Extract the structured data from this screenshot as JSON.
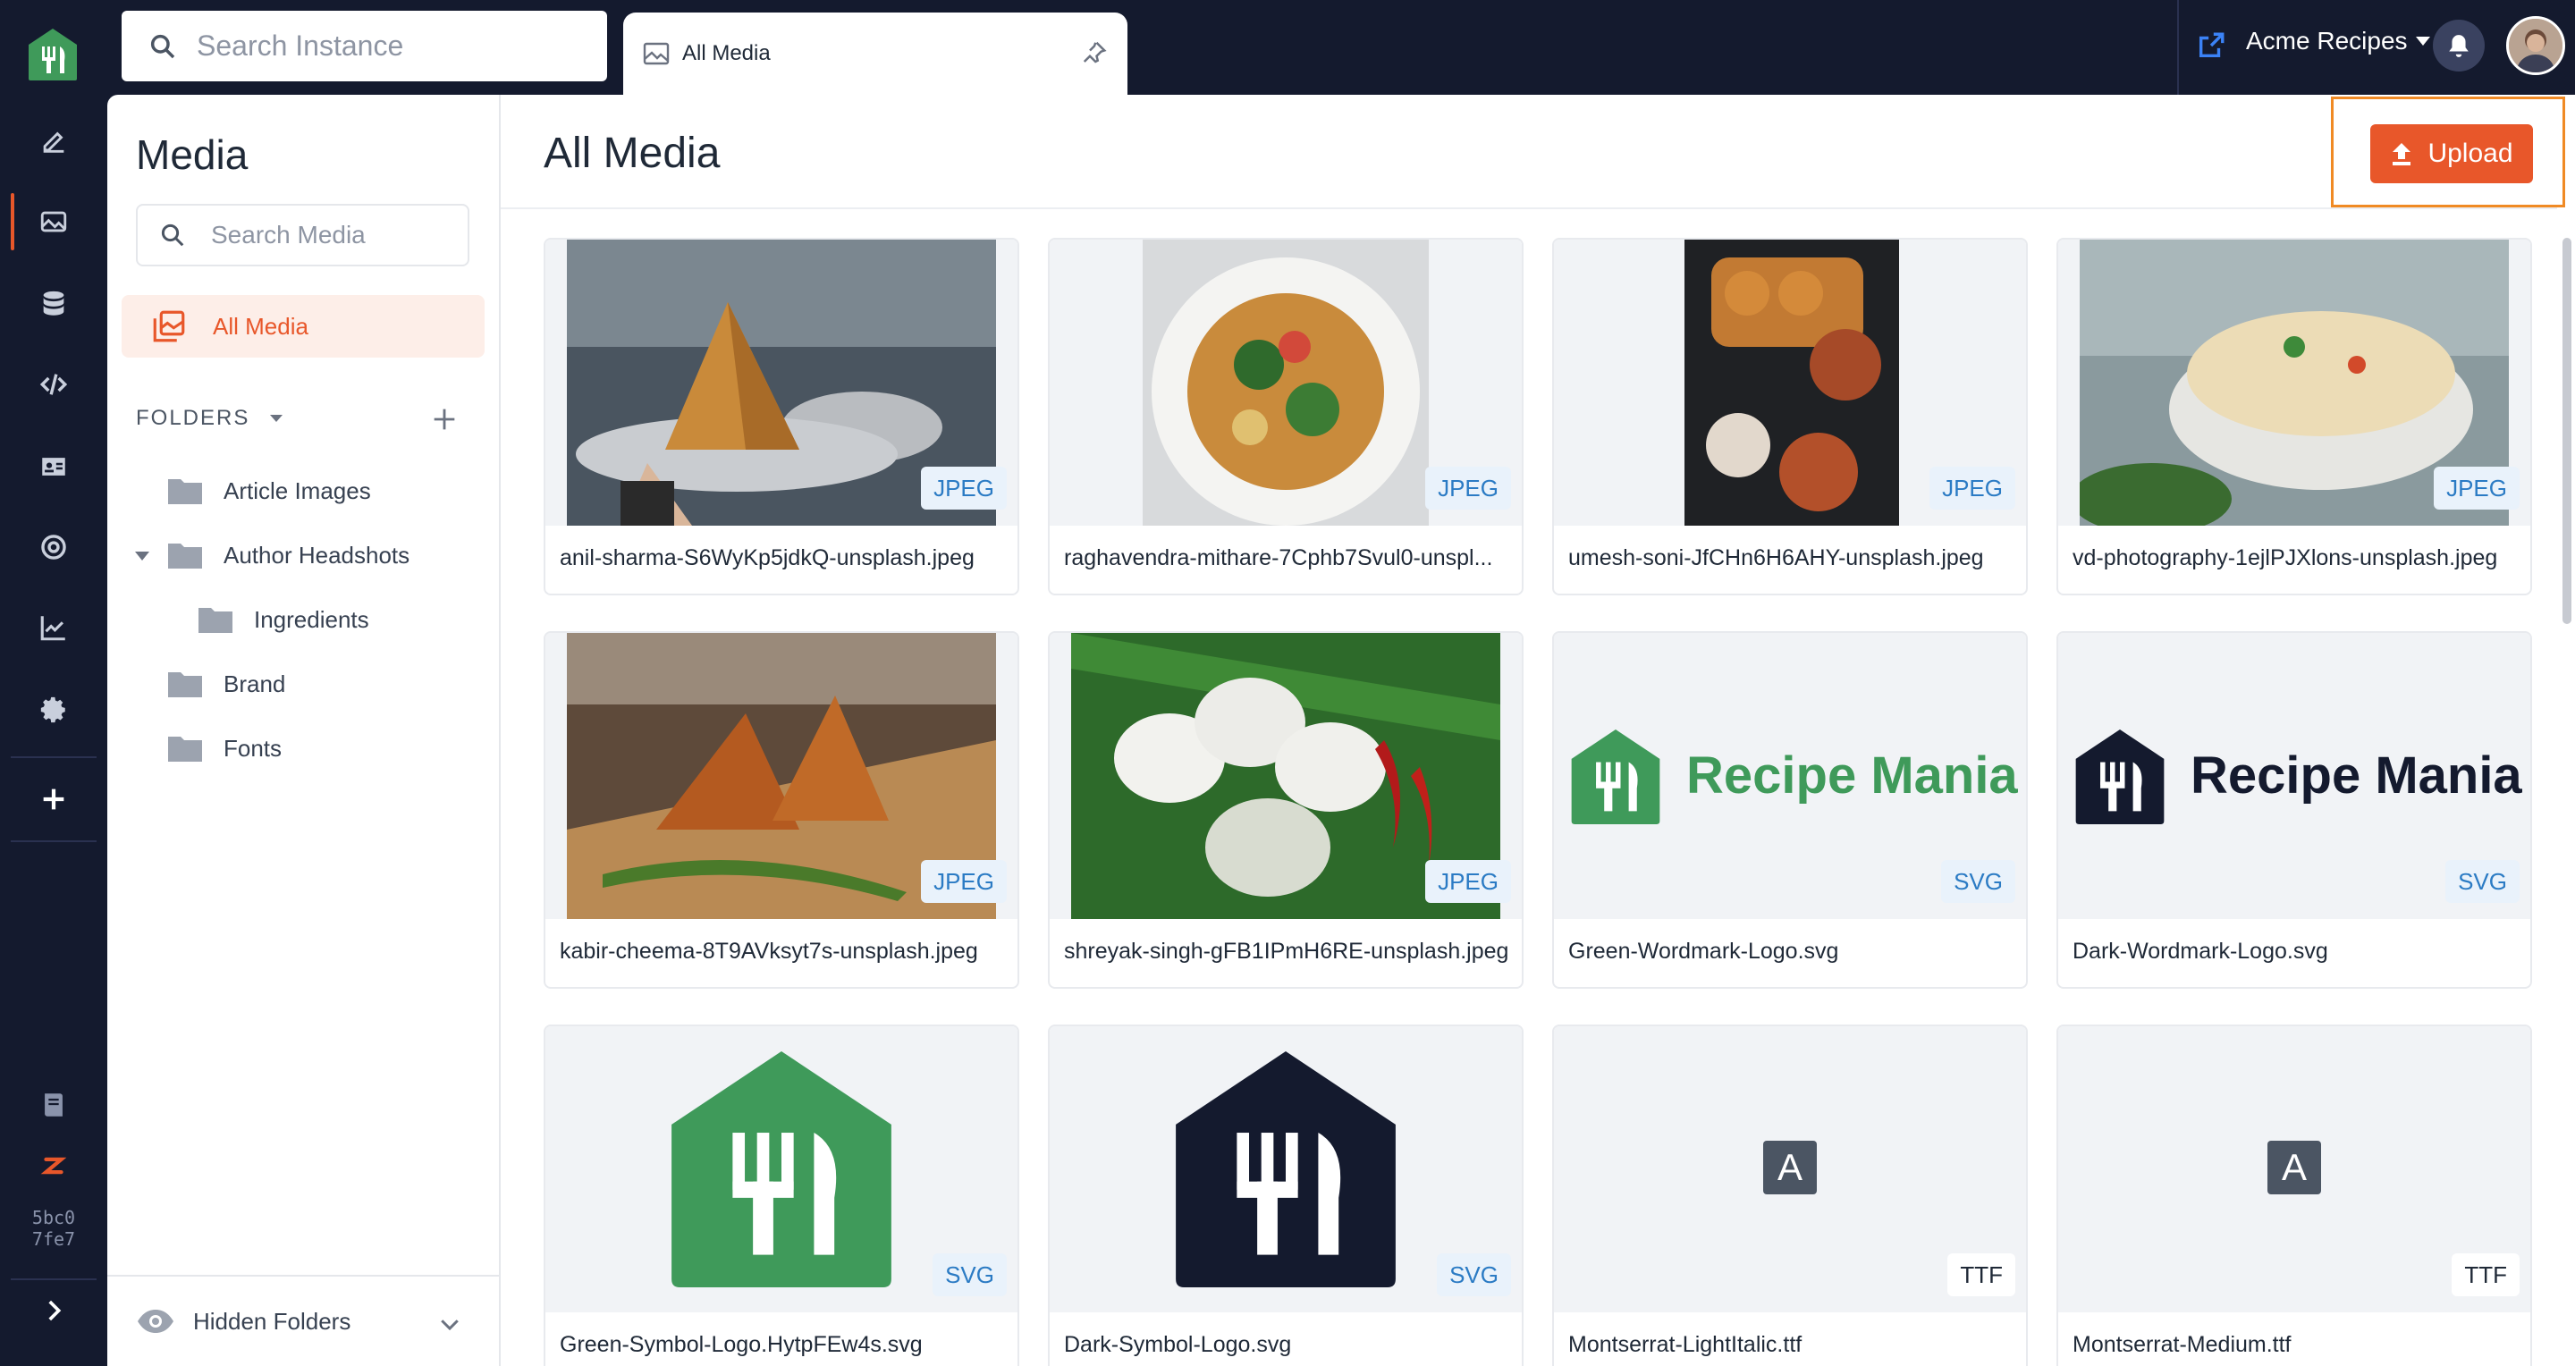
{
  "rail": {
    "items": [
      "edit-icon",
      "image-icon",
      "database-icon",
      "code-icon",
      "id-card-icon",
      "target-icon",
      "chart-icon",
      "gear-icon",
      "plus-icon"
    ],
    "footer_icons": [
      "book-icon",
      "brand-icon",
      "expand-chevron-icon"
    ],
    "hash_line1": "5bc0",
    "hash_line2": "7fe7"
  },
  "topbar": {
    "search_placeholder": "Search Instance",
    "tab_label": "All Media",
    "account_name": "Acme Recipes"
  },
  "sidebar": {
    "title": "Media",
    "search_placeholder": "Search Media",
    "all_media_label": "All Media",
    "folders_label": "FOLDERS",
    "folders": [
      {
        "name": "Article Images"
      },
      {
        "name": "Author Headshots"
      },
      {
        "name": "Ingredients"
      },
      {
        "name": "Brand"
      },
      {
        "name": "Fonts"
      }
    ],
    "hidden_folders_label": "Hidden Folders"
  },
  "main": {
    "title": "All Media",
    "upload_label": "Upload",
    "assets": [
      {
        "filename": "anil-sharma-S6WyKp5jdkQ-unsplash.jpeg",
        "type": "JPEG"
      },
      {
        "filename": "raghavendra-mithare-7Cphb7Svul0-unspl...",
        "type": "JPEG"
      },
      {
        "filename": "umesh-soni-JfCHn6H6AHY-unsplash.jpeg",
        "type": "JPEG"
      },
      {
        "filename": "vd-photography-1ejlPJXlons-unsplash.jpeg",
        "type": "JPEG"
      },
      {
        "filename": "kabir-cheema-8T9AVksyt7s-unsplash.jpeg",
        "type": "JPEG"
      },
      {
        "filename": "shreyak-singh-gFB1IPmH6RE-unsplash.jpeg",
        "type": "JPEG"
      },
      {
        "filename": "Green-Wordmark-Logo.svg",
        "type": "SVG",
        "preview_text": "Recipe Mania"
      },
      {
        "filename": "Dark-Wordmark-Logo.svg",
        "type": "SVG",
        "preview_text": "Recipe Mania"
      },
      {
        "filename": "Green-Symbol-Logo.HytpFEw4s.svg",
        "type": "SVG"
      },
      {
        "filename": "Dark-Symbol-Logo.svg",
        "type": "SVG"
      },
      {
        "filename": "Montserrat-LightItalic.ttf",
        "type": "TTF",
        "preview_text": "A"
      },
      {
        "filename": "Montserrat-Medium.ttf",
        "type": "TTF",
        "preview_text": "A"
      }
    ]
  },
  "colors": {
    "rail_bg": "#141a2e",
    "accent": "#e8572a",
    "brand_green": "#3f9a5a",
    "brand_dark": "#141a2e",
    "badge_blue": "#2b7bc4",
    "highlight": "#f08a24"
  }
}
